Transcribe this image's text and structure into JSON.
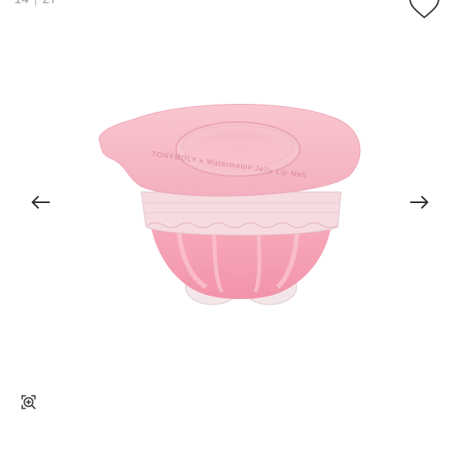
{
  "gallery": {
    "current": "14",
    "separator": "|",
    "total": "27"
  },
  "icons": {
    "wishlist": "heart-outline-icon",
    "prev": "arrow-left-icon",
    "next": "arrow-right-icon",
    "zoom": "zoom-in-icon"
  },
  "product_image": {
    "lid_text": "TONYMOLY x Watermelon Jelly Lip Melt"
  },
  "colors": {
    "lid": "#f5b8c4",
    "jelly": "#f49aae",
    "icon": "#333333"
  }
}
